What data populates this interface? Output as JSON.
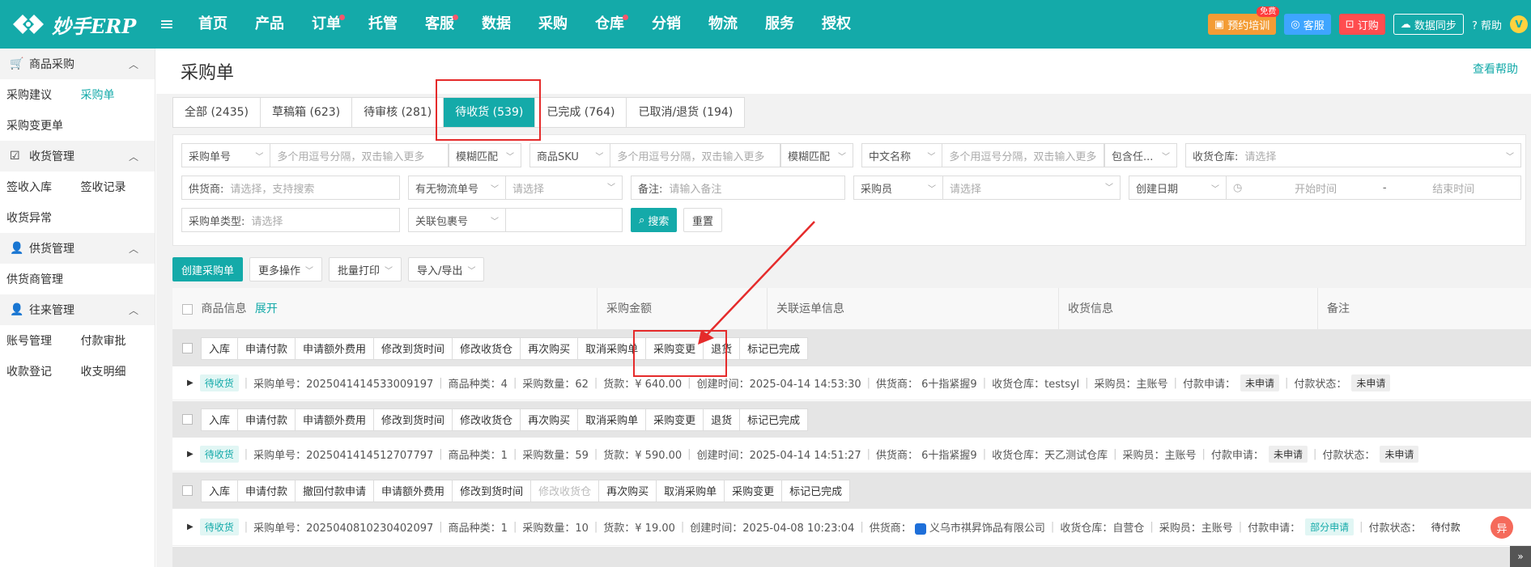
{
  "app": {
    "logo_text": "妙手ERP"
  },
  "nav": [
    {
      "label": "首页",
      "dot": false
    },
    {
      "label": "产品",
      "dot": false
    },
    {
      "label": "订单",
      "dot": true
    },
    {
      "label": "托管",
      "dot": false
    },
    {
      "label": "客服",
      "dot": true
    },
    {
      "label": "数据",
      "dot": false
    },
    {
      "label": "采购",
      "dot": false
    },
    {
      "label": "仓库",
      "dot": true
    },
    {
      "label": "分销",
      "dot": false
    },
    {
      "label": "物流",
      "dot": false
    },
    {
      "label": "服务",
      "dot": false
    },
    {
      "label": "授权",
      "dot": false
    }
  ],
  "top_right": {
    "training": "预约培训",
    "free": "免费",
    "kefu": "客服",
    "order": "订购",
    "sync": "数据同步",
    "help": "帮助",
    "avatar": "V"
  },
  "sidebar": {
    "g1": "商品采购",
    "g1_items": [
      "采购建议",
      "采购单",
      "采购变更单"
    ],
    "g2": "收货管理",
    "g2_items": [
      "签收入库",
      "签收记录",
      "收货异常"
    ],
    "g3": "供货管理",
    "g3_items": [
      "供货商管理"
    ],
    "g4": "往来管理",
    "g4_items": [
      "账号管理",
      "付款审批",
      "收款登记",
      "收支明细"
    ]
  },
  "page": {
    "title": "采购单",
    "help_link": "查看帮助"
  },
  "tabs": [
    "全部 (2435)",
    "草稿箱 (623)",
    "待审核 (281)",
    "待收货 (539)",
    "已完成 (764)",
    "已取消/退货 (194)"
  ],
  "filters": {
    "po_no": "采购单号",
    "po_no_ph": "多个用逗号分隔，双击输入更多",
    "fuzzy1": "模糊匹配",
    "sku": "商品SKU",
    "sku_ph": "多个用逗号分隔，双击输入更多",
    "fuzzy2": "模糊匹配",
    "cn_name": "中文名称",
    "cn_name_ph": "多个用逗号分隔，双击输入更多",
    "contains": "包含任...",
    "warehouse_label": "收货仓库:",
    "warehouse_ph": "请选择",
    "supplier_label": "供货商:",
    "supplier_ph": "请选择，支持搜索",
    "logistics": "有无物流单号",
    "logistics_ph": "请选择",
    "remark_label": "备注:",
    "remark_ph": "请输入备注",
    "buyer": "采购员",
    "buyer_ph": "请选择",
    "date_type": "创建日期",
    "start": "开始时间",
    "dash": "-",
    "end": "结束时间",
    "po_type_label": "采购单类型:",
    "po_type_ph": "请选择",
    "pkg": "关联包裹号",
    "search": "搜索",
    "reset": "重置"
  },
  "actions": [
    "创建采购单",
    "更多操作",
    "批量打印",
    "导入/导出"
  ],
  "table_head": {
    "product": "商品信息",
    "expand": "展开",
    "amount": "采购金额",
    "waybill": "关联运单信息",
    "receive": "收货信息",
    "remark": "备注"
  },
  "op_sets": [
    [
      "入库",
      "申请付款",
      "申请额外费用",
      "修改到货时间",
      "修改收货仓",
      "再次购买",
      "取消采购单",
      "采购变更",
      "退货",
      "标记已完成"
    ],
    [
      "入库",
      "申请付款",
      "申请额外费用",
      "修改到货时间",
      "修改收货仓",
      "再次购买",
      "取消采购单",
      "采购变更",
      "退货",
      "标记已完成"
    ],
    [
      "入库",
      "申请付款",
      "撤回付款申请",
      "申请额外费用",
      "修改到货时间",
      "修改收货仓",
      "再次购买",
      "取消采购单",
      "采购变更",
      "标记已完成"
    ]
  ],
  "orders": [
    {
      "status": "待收货",
      "po": "采购单号：2025041414533009197",
      "kinds": "商品种类：4",
      "qty": "采购数量：62",
      "amount": "货款：¥ 640.00",
      "created": "创建时间：2025-04-14 14:53:30",
      "supplier": "供货商： 6十指紧握9",
      "warehouse": "收货仓库：testsyl",
      "buyer": "采购员：主账号",
      "pay_apply_label": "付款申请：",
      "pay_apply": "未申请",
      "pay_status_label": "付款状态：",
      "pay_status": "未申请"
    },
    {
      "status": "待收货",
      "po": "采购单号：2025041414512707797",
      "kinds": "商品种类：1",
      "qty": "采购数量：59",
      "amount": "货款：¥ 590.00",
      "created": "创建时间：2025-04-14 14:51:27",
      "supplier": "供货商： 6十指紧握9",
      "warehouse": "收货仓库：天乙测试仓库",
      "buyer": "采购员：主账号",
      "pay_apply_label": "付款申请：",
      "pay_apply": "未申请",
      "pay_status_label": "付款状态：",
      "pay_status": "未申请"
    },
    {
      "status": "待收货",
      "po": "采购单号：2025040810230402097",
      "kinds": "商品种类：1",
      "qty": "采购数量：10",
      "amount": "货款：¥ 19.00",
      "created": "创建时间：2025-04-08 10:23:04",
      "supplier": "供货商：",
      "supplier_name": "义乌市祺昇饰品有限公司",
      "warehouse": "收货仓库：自营仓",
      "buyer": "采购员：主账号",
      "pay_apply_label": "付款申请：",
      "pay_apply": "部分申请",
      "pay_status_label": "付款状态：",
      "pay_status": "待付款"
    }
  ],
  "float_btn": "异",
  "corner": "»",
  "colors": {
    "brand": "#14aaa9",
    "highlight": "#e52b2b"
  }
}
